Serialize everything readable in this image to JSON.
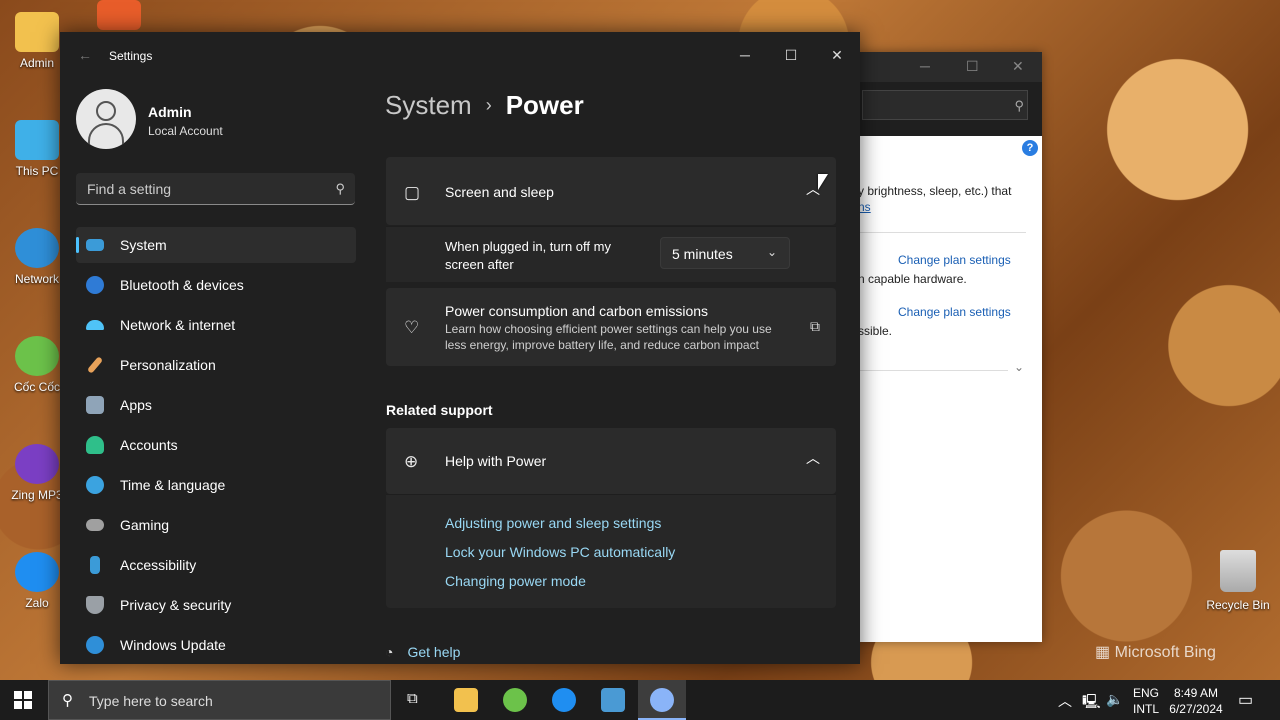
{
  "desktop": {
    "icons": [
      {
        "label": "Admin"
      },
      {
        "label": "This PC"
      },
      {
        "label": "Network"
      },
      {
        "label": "Cốc Cốc"
      },
      {
        "label": "Zing MP3"
      },
      {
        "label": "Zalo"
      }
    ],
    "recycle_bin": "Recycle Bin",
    "watermark": "Microsoft Bing"
  },
  "control_panel": {
    "text1": "y brightness, sleep, etc.) that",
    "link1": "ns",
    "change_plan_1": "Change plan settings",
    "text2": "n capable hardware.",
    "change_plan_2": "Change plan settings",
    "text3": "ssible."
  },
  "settings": {
    "window_title": "Settings",
    "profile": {
      "name": "Admin",
      "account_type": "Local Account"
    },
    "search_placeholder": "Find a setting",
    "nav": [
      {
        "label": "System",
        "icon": "system-icon",
        "color": "#3b9bd8"
      },
      {
        "label": "Bluetooth & devices",
        "icon": "bluetooth-icon",
        "color": "#2f7bd6"
      },
      {
        "label": "Network & internet",
        "icon": "wifi-icon",
        "color": "#4fc3f7"
      },
      {
        "label": "Personalization",
        "icon": "brush-icon",
        "color": "#e8a25a"
      },
      {
        "label": "Apps",
        "icon": "apps-icon",
        "color": "#8fa4b8"
      },
      {
        "label": "Accounts",
        "icon": "accounts-icon",
        "color": "#2fbf8a"
      },
      {
        "label": "Time & language",
        "icon": "globe-clock-icon",
        "color": "#3ba3e0"
      },
      {
        "label": "Gaming",
        "icon": "gamepad-icon",
        "color": "#a0a0a0"
      },
      {
        "label": "Accessibility",
        "icon": "accessibility-icon",
        "color": "#3b9bd8"
      },
      {
        "label": "Privacy & security",
        "icon": "shield-icon",
        "color": "#9aa0a6"
      },
      {
        "label": "Windows Update",
        "icon": "update-icon",
        "color": "#2f8fd8"
      }
    ],
    "breadcrumb": {
      "parent": "System",
      "current": "Power"
    },
    "screen_sleep": {
      "title": "Screen and sleep",
      "plugged_label": "When plugged in, turn off my screen after",
      "plugged_value": "5 minutes"
    },
    "carbon": {
      "title": "Power consumption and carbon emissions",
      "description": "Learn how choosing efficient power settings can help you use less energy, improve battery life, and reduce carbon impact"
    },
    "related_support": "Related support",
    "help": {
      "title": "Help with Power",
      "links": [
        "Adjusting power and sleep settings",
        "Lock your Windows PC automatically",
        "Changing power mode"
      ]
    },
    "get_help": "Get help"
  },
  "taskbar": {
    "search_placeholder": "Type here to search",
    "language": {
      "line1": "ENG",
      "line2": "INTL"
    },
    "time": "8:49 AM",
    "date": "6/27/2024"
  },
  "colors": {
    "accent": "#4cc2ff",
    "link": "#99d8f4",
    "window_bg": "#202020",
    "card_bg": "#2b2b2b"
  }
}
